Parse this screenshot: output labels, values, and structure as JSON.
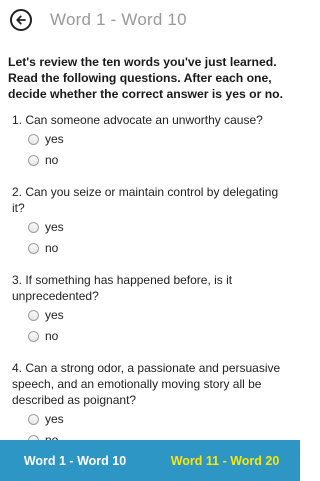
{
  "header": {
    "title": "Word 1 - Word 10",
    "back_icon": "back-arrow-icon"
  },
  "intro": "Let's review the ten words you've just learned. Read the following questions. After each one, decide whether the correct answer is yes or no.",
  "questions": [
    {
      "text": "1. Can someone advocate an unworthy cause?",
      "options": [
        "yes",
        "no"
      ]
    },
    {
      "text": "2. Can you seize or maintain control by delegating it?",
      "options": [
        "yes",
        "no"
      ]
    },
    {
      "text": "3. If something has happened before, is it unprecedented?",
      "options": [
        "yes",
        "no"
      ]
    },
    {
      "text": "4. Can a strong odor, a passionate and persuasive speech, and an emotionally moving story all be described as poignant?",
      "options": [
        "yes",
        "no"
      ]
    }
  ],
  "footer": {
    "tab1": "Word 1 - Word 10",
    "tab2": "Word 11 - Word 20",
    "colors": {
      "bar": "#2e96c5",
      "active": "#ffe600",
      "inactive": "#ffffff"
    }
  }
}
